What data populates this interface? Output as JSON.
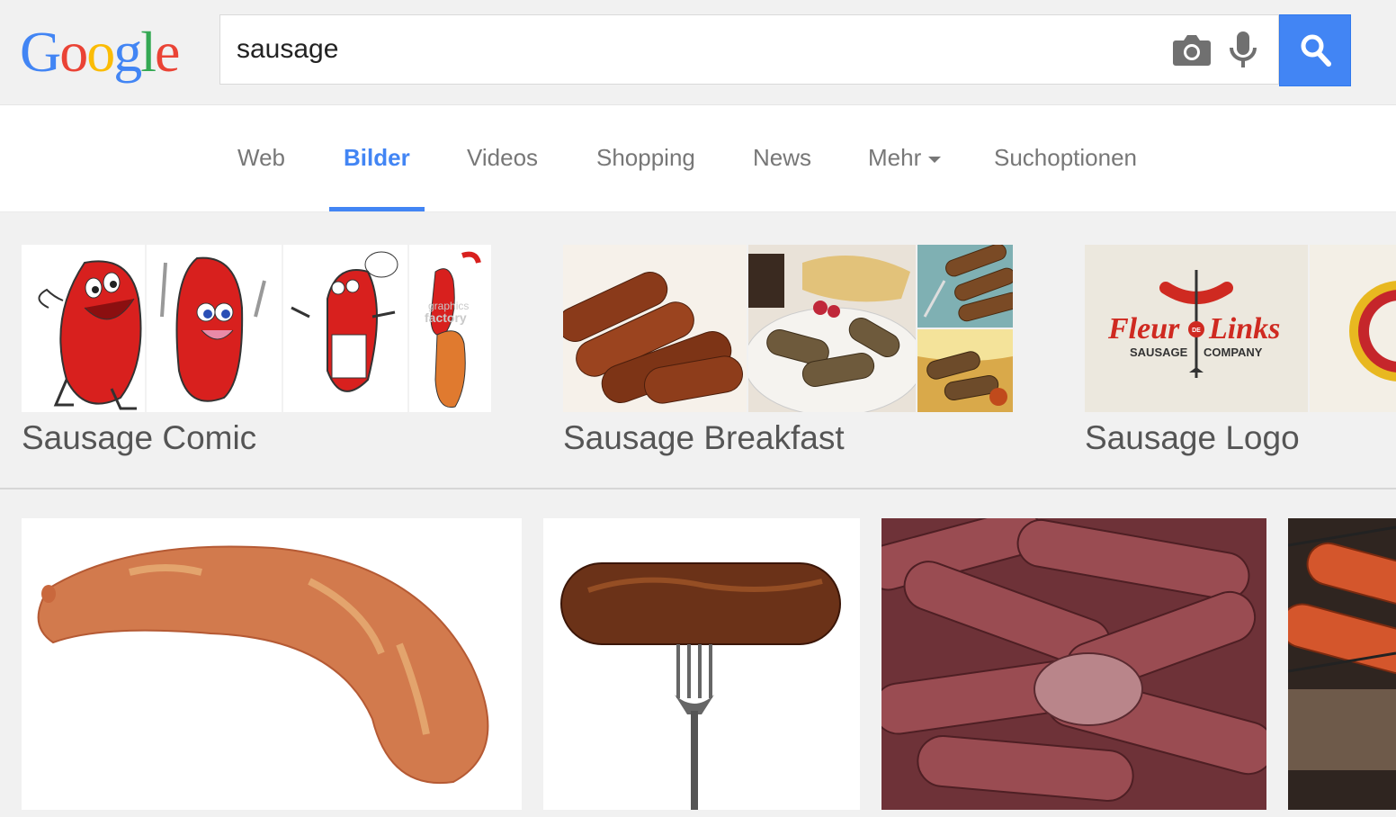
{
  "logo": {
    "text": "Google",
    "letters": [
      {
        "ch": "G",
        "color": "#4285f4"
      },
      {
        "ch": "o",
        "color": "#ea4335"
      },
      {
        "ch": "o",
        "color": "#fbbc05"
      },
      {
        "ch": "g",
        "color": "#4285f4"
      },
      {
        "ch": "l",
        "color": "#34a853"
      },
      {
        "ch": "e",
        "color": "#ea4335"
      }
    ]
  },
  "search": {
    "query": "sausage",
    "camera_icon": "camera-icon",
    "mic_icon": "mic-icon",
    "button_icon": "search-icon",
    "accent": "#4285f4"
  },
  "tabs": [
    {
      "label": "Web",
      "active": false
    },
    {
      "label": "Bilder",
      "active": true
    },
    {
      "label": "Videos",
      "active": false
    },
    {
      "label": "Shopping",
      "active": false
    },
    {
      "label": "News",
      "active": false
    },
    {
      "label": "Mehr",
      "active": false,
      "dropdown": true
    },
    {
      "label": "Suchoptionen",
      "active": false
    }
  ],
  "related": [
    {
      "label": "Sausage Comic"
    },
    {
      "label": "Sausage Breakfast"
    },
    {
      "label": "Sausage Logo",
      "logo_text": {
        "brand_left": "Fleur",
        "brand_mid": "DE",
        "brand_right": "Links",
        "sub_left": "SAUSAGE",
        "sub_right": "COMPANY"
      }
    }
  ],
  "watermark": {
    "line1": "graphics",
    "line2": "factory"
  },
  "results_count_visible": 4
}
